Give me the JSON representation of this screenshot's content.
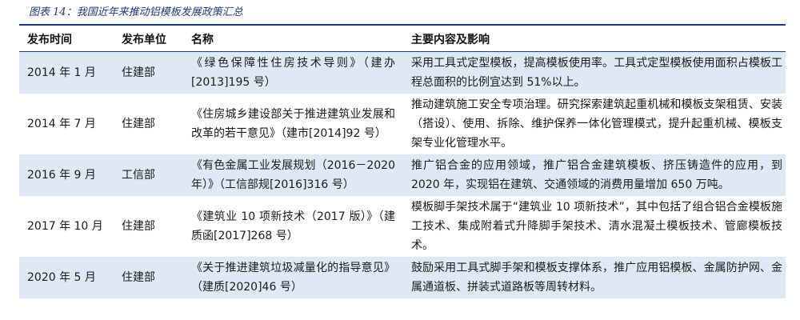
{
  "caption": "图表 14：我国近年来推动铝模板发展政策汇总",
  "headers": {
    "date": "发布时间",
    "unit": "发布单位",
    "name": "名称",
    "content": "主要内容及影响"
  },
  "rows": [
    {
      "date": "2014 年 1 月",
      "unit": "住建部",
      "name": "《绿色保障性住房技术导则》（建办[2013]195 号）",
      "content": "采用工具式定型模板，提高模板使用率。工具式定型模板使用面积占模板工程总面积的比例宜达到 51%以上。"
    },
    {
      "date": "2014 年 7 月",
      "unit": "住建部",
      "name": "《住房城乡建设部关于推进建筑业发展和改革的若干意见》（建市[2014]92 号）",
      "content": "推动建筑施工安全专项治理。研究探索建筑起重机械和模板支架租赁、安装（搭设）、使用、拆除、维护保养一体化管理模式，提升起重机械、模板支架专业化管理水平。"
    },
    {
      "date": "2016 年 9 月",
      "unit": "工信部",
      "name": "《有色金属工业发展规划（2016－2020 年）》（工信部规[2016]316 号）",
      "content": "推广铝合金的应用领域，推广铝合金建筑模板、挤压铸造件的应用，到 2020 年，实现铝在建筑、交通领域的消费用量增加 650 万吨。"
    },
    {
      "date": "2017 年 10 月",
      "unit": "住建部",
      "name": "《建筑业 10 项新技术（2017 版）》（建质函[2017]268 号）",
      "content": "模板脚手架技术属于“建筑业 10 项新技术”，其中包括了组合铝合金模板施工技术、集成附着式升降脚手架技术、清水混凝土模板技术、管廊模板技术。"
    },
    {
      "date": "2020 年 5 月",
      "unit": "住建部",
      "name": "《关于推进建筑垃圾减量化的指导意见》（建质[2020]46 号）",
      "content": "鼓励采用工具式脚手架和模板支撑体系，推广应用铝模板、金属防护网、金属通道板、拼装式道路板等周转材料。"
    }
  ]
}
